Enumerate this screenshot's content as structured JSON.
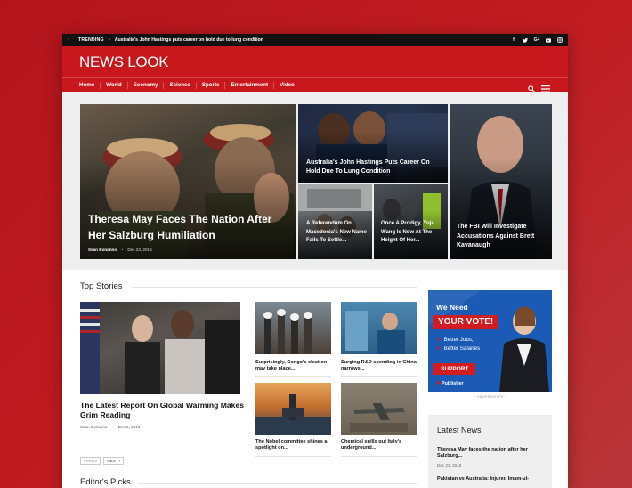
{
  "topbar": {
    "label": "TRENDING",
    "headline": "Australia's John Hastings puts career on hold due to lung condition",
    "social_icons": [
      "facebook-icon",
      "twitter-icon",
      "google-plus-icon",
      "youtube-icon",
      "instagram-icon"
    ]
  },
  "site": {
    "logo": "NEWS LOOK",
    "brand_color": "#c8171d"
  },
  "nav": {
    "items": [
      "Home",
      "World",
      "Economy",
      "Science",
      "Sports",
      "Entertainment",
      "Video"
    ]
  },
  "hero": {
    "main": {
      "title": "Theresa May Faces The Nation After Her Salzburg Humiliation",
      "author": "Sean Bonanno",
      "date": "Dec 23, 2018"
    },
    "top_middle": {
      "title": "Australia's John Hastings Puts Career On Hold Due To Lung Condition"
    },
    "small_left": {
      "title": "A Referendum On Macedonia's New Name Fails To Settle..."
    },
    "small_right": {
      "title": "Once A Prodigy, Yuja Wang Is Now At The Height Of Her..."
    },
    "right": {
      "title": "The FBI Will Investigate Accusations Against Brett Kavanaugh"
    }
  },
  "top_stories": {
    "heading": "Top Stories",
    "featured": {
      "title": "The Latest Report On Global Warming Makes Grim Reading",
      "author": "Sean Bonanno",
      "date": "Dec 8, 2018"
    },
    "cards": [
      {
        "title": "Surprisingly, Congo's election may take place..."
      },
      {
        "title": "Surging R&D spending in China narrows..."
      },
      {
        "title": "The Nobel committee shines a spotlight on..."
      },
      {
        "title": "Chemical spills put Italy's underground..."
      }
    ],
    "pager": {
      "prev": "‹ PREV",
      "next": "NEXT ›"
    }
  },
  "editors_picks": {
    "heading": "Editor's Picks"
  },
  "ad": {
    "line1": "We Need",
    "line2": "YOUR VOTE!",
    "bullet1": "Better Jobs,",
    "bullet2": "Better Salaries",
    "button": "SUPPORT",
    "publisher": "Publisher",
    "caption": "- Advertisement -"
  },
  "latest_news": {
    "heading": "Latest News",
    "items": [
      {
        "title": "Theresa May faces the nation after her Salzburg...",
        "date": "Dec 23, 2018"
      },
      {
        "title": "Pakistan vs Australia: Injured Imam-ul-",
        "date": ""
      }
    ]
  }
}
